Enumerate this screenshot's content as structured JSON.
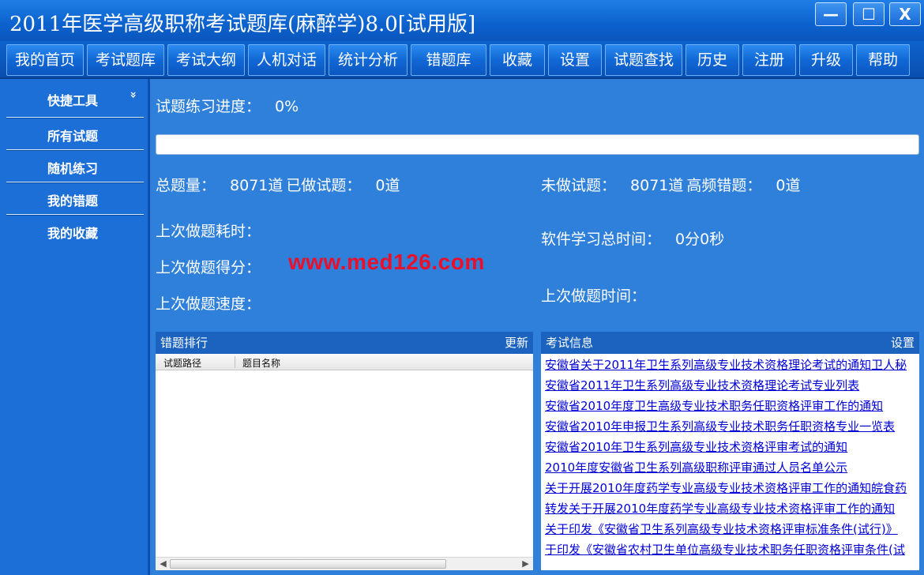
{
  "window": {
    "title": "2011年医学高级职称考试题库(麻醉学)8.0[试用版]",
    "minimize": "—",
    "maximize": "☐",
    "close": "X"
  },
  "menu": [
    "我的首页",
    "考试题库",
    "考试大纲",
    "人机对话",
    "统计分析",
    "错题库",
    "收藏",
    "设置",
    "试题查找",
    "历史",
    "注册",
    "升级",
    "帮助"
  ],
  "sidebar": {
    "header": "快捷工具",
    "chevron": "»",
    "items": [
      "所有试题",
      "随机练习",
      "我的错题",
      "我的收藏"
    ]
  },
  "stats": {
    "progress_label": "试题练习进度：",
    "progress_value": "0%",
    "progress_fraction": 0,
    "total_label": "总题量：",
    "total_value": "8071道",
    "done_label": "已做试题：",
    "done_value": "0道",
    "undone_label": "未做试题：",
    "undone_value": "8071道",
    "frequent_label": "高频错题：",
    "frequent_value": "0道",
    "last_duration_label": "上次做题耗时：",
    "study_total_label": "软件学习总时间：",
    "study_total_value": "0分0秒",
    "last_score_label": "上次做题得分：",
    "watermark": "www.med126.com",
    "last_speed_label": "上次做题速度：",
    "last_time_label": "上次做题时间："
  },
  "rank_panel": {
    "title": "错题排行",
    "action": "更新",
    "columns": [
      "试题路径",
      "题目名称"
    ]
  },
  "info_panel": {
    "title": "考试信息",
    "action": "设置",
    "links": [
      "安徽省关于2011年卫生系列高级专业技术资格理论考试的通知卫人秘",
      "安徽省2011年卫生系列高级专业技术资格理论考试专业列表",
      "安徽省2010年度卫生高级专业技术职务任职资格评审工作的通知",
      "安徽省2010年申报卫生系列高级专业技术职务任职资格专业一览表",
      "安徽省2010年卫生系列高级专业技术资格评审考试的通知",
      "2010年度安徽省卫生系列高级职称评审通过人员名单公示",
      "关于开展2010年度药学专业高级专业技术资格评审工作的通知皖食药",
      "转发关于开展2010年度药学专业高级专业技术资格评审工作的通知",
      "关于印发《安徽省卫生系列高级专业技术资格评审标准条件(试行)》",
      "于印发《安徽省农村卫生单位高级专业技术职务任职资格评审条件(试"
    ]
  }
}
